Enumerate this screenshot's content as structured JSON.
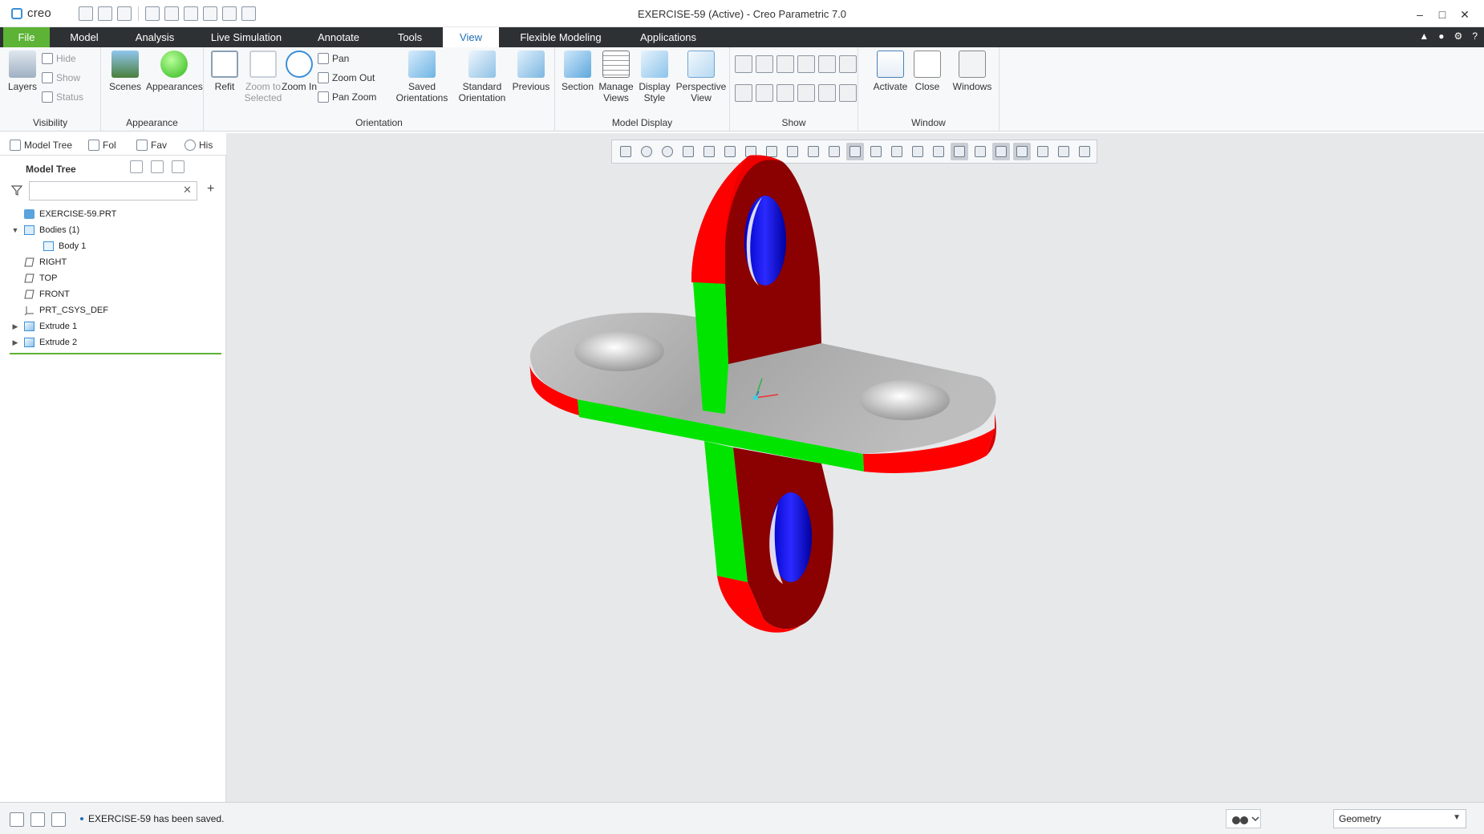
{
  "app": {
    "logo": "creo",
    "title": "EXERCISE-59 (Active) - Creo Parametric 7.0"
  },
  "tabs": [
    {
      "label": "File"
    },
    {
      "label": "Model"
    },
    {
      "label": "Analysis"
    },
    {
      "label": "Live Simulation"
    },
    {
      "label": "Annotate"
    },
    {
      "label": "Tools"
    },
    {
      "label": "View"
    },
    {
      "label": "Flexible Modeling"
    },
    {
      "label": "Applications"
    }
  ],
  "active_tab": "View",
  "ribbon": {
    "visibility": {
      "label": "Visibility",
      "layers": "Layers",
      "hide": "Hide",
      "show": "Show",
      "status": "Status"
    },
    "appearance": {
      "label": "Appearance",
      "scenes": "Scenes",
      "appearances": "Appearances"
    },
    "orientation": {
      "label": "Orientation",
      "refit": "Refit",
      "zoom_selected": "Zoom to Selected",
      "zoom_in": "Zoom In",
      "pan": "Pan",
      "zoom_out": "Zoom Out",
      "pan_zoom": "Pan Zoom",
      "saved": "Saved Orientations",
      "standard": "Standard Orientation",
      "previous": "Previous"
    },
    "model_display": {
      "label": "Model Display",
      "section": "Section",
      "manage_views": "Manage Views",
      "display_style": "Display Style",
      "perspective": "Perspective View"
    },
    "show": {
      "label": "Show"
    },
    "window": {
      "label": "Window",
      "activate": "Activate",
      "close": "Close",
      "windows": "Windows"
    }
  },
  "navigator": {
    "tabs": [
      "Model Tree",
      "Fol",
      "Fav",
      "His"
    ],
    "header": "Model Tree",
    "search": {
      "value": "",
      "placeholder": ""
    },
    "tree": [
      {
        "label": "EXERCISE-59.PRT",
        "icon": "part-icon"
      },
      {
        "label": "Bodies (1)",
        "icon": "bodies-icon"
      },
      {
        "label": "Body 1",
        "icon": "body-icon"
      },
      {
        "label": "RIGHT",
        "icon": "datum-plane-icon"
      },
      {
        "label": "TOP",
        "icon": "datum-plane-icon"
      },
      {
        "label": "FRONT",
        "icon": "datum-plane-icon"
      },
      {
        "label": "PRT_CSYS_DEF",
        "icon": "csys-icon"
      },
      {
        "label": "Extrude 1",
        "icon": "extrude-icon"
      },
      {
        "label": "Extrude 2",
        "icon": "extrude-icon"
      }
    ]
  },
  "colors": {
    "face_red": "#ff0000",
    "face_dark_red": "#8b0000",
    "face_green": "#00ff00",
    "face_gray": "#b8b8b8",
    "hole_blue": "#0000ff",
    "accent_green": "#5cb335",
    "ribbon_dark": "#2e3133"
  },
  "status": {
    "message": "EXERCISE-59 has been saved.",
    "filter_value": "Geometry"
  }
}
